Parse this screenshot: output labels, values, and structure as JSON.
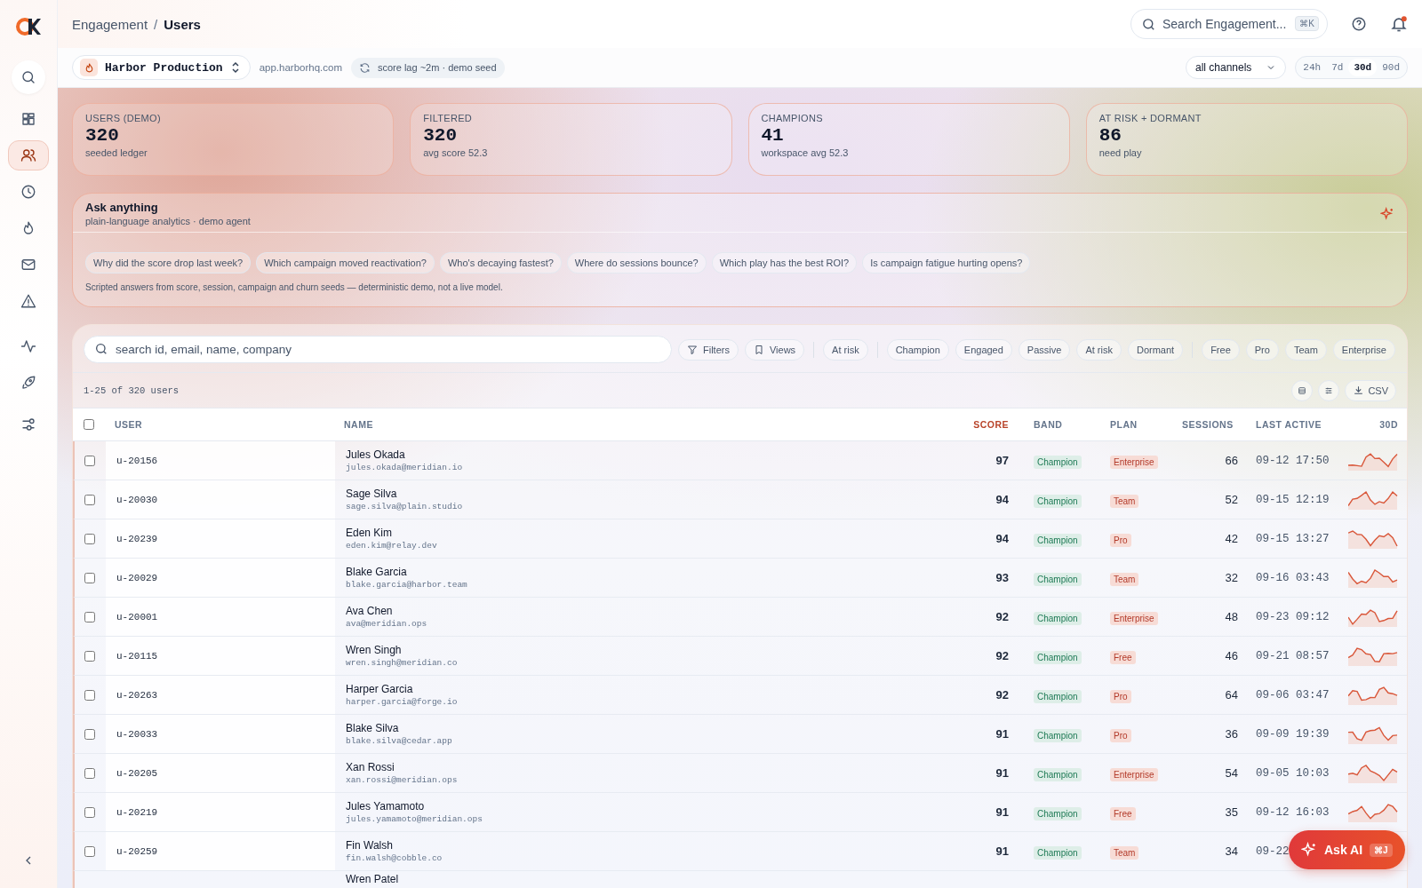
{
  "sidebar": {
    "items": [
      {
        "selected": false
      },
      {
        "selected": false
      },
      {
        "selected": true
      },
      {
        "selected": false
      },
      {
        "selected": false
      },
      {
        "selected": false
      },
      {
        "selected": false
      },
      {
        "selected": false
      },
      {
        "selected": false
      },
      {
        "selected": false
      }
    ]
  },
  "header": {
    "breadcrumb": [
      "Engagement",
      "Users"
    ],
    "separator": "/",
    "search": {
      "placeholder": "Search Engagement...",
      "shortcut": "⌘K"
    },
    "notifications": {
      "unread": true
    }
  },
  "subbar": {
    "workspace": "Harbor Production",
    "domain": "app.harborhq.com",
    "status": "score lag ~2m · demo seed",
    "channel": "all channels",
    "ranges": [
      {
        "label": "24h",
        "selected": false
      },
      {
        "label": "7d",
        "selected": false
      },
      {
        "label": "30d",
        "selected": true
      },
      {
        "label": "90d",
        "selected": false
      }
    ]
  },
  "stats": [
    {
      "label": "USERS (DEMO)",
      "value": "320",
      "note": "seeded ledger"
    },
    {
      "label": "FILTERED",
      "value": "320",
      "note": "avg score 52.3"
    },
    {
      "label": "CHAMPIONS",
      "value": "41",
      "note": "workspace avg 52.3"
    },
    {
      "label": "AT RISK + DORMANT",
      "value": "86",
      "note": "need play"
    }
  ],
  "ask": {
    "title": "Ask anything",
    "subtitle": "plain-language analytics · demo agent",
    "suggestions": [
      "Why did the score drop last week?",
      "Which campaign moved reactivation?",
      "Who's decaying fastest?",
      "Where do sessions bounce?",
      "Which play has the best ROI?",
      "Is campaign fatigue hurting opens?"
    ],
    "footnote": "Scripted answers from score, session, campaign and churn seeds — deterministic demo, not a live model."
  },
  "toolbar": {
    "search_placeholder": "search id, email, name, company",
    "buttons": [
      "Filters",
      "Views"
    ],
    "chip_groups": [
      [
        {
          "label": "At risk",
          "selected": false
        }
      ],
      [
        {
          "label": "Champion",
          "selected": false
        },
        {
          "label": "Engaged",
          "selected": false
        },
        {
          "label": "Passive",
          "selected": false
        },
        {
          "label": "At risk",
          "selected": false
        },
        {
          "label": "Dormant",
          "selected": false
        }
      ],
      [
        {
          "label": "Free",
          "selected": false
        },
        {
          "label": "Pro",
          "selected": false
        },
        {
          "label": "Team",
          "selected": false
        },
        {
          "label": "Enterprise",
          "selected": false
        }
      ]
    ]
  },
  "table": {
    "count": "1-25 of 320 users",
    "export": "CSV",
    "all_checked": false,
    "columns": [
      {
        "label": "USER",
        "sorted": false
      },
      {
        "label": "NAME",
        "sorted": false
      },
      {
        "label": "SCORE",
        "sorted": true
      },
      {
        "label": "BAND",
        "sorted": false
      },
      {
        "label": "PLAN",
        "sorted": false
      },
      {
        "label": "SESSIONS",
        "sorted": false
      },
      {
        "label": "LAST ACTIVE",
        "sorted": false
      },
      {
        "label": "30D",
        "sorted": false
      }
    ],
    "rows": [
      {
        "checked": false,
        "user": "u-20156",
        "name": "Jules Okada",
        "email": "jules.okada@meridian.io",
        "score": "97",
        "band": "Champion",
        "plan": "Enterprise",
        "sessions": "66",
        "last_active": "09-12 17:50"
      },
      {
        "checked": false,
        "user": "u-20030",
        "name": "Sage Silva",
        "email": "sage.silva@plain.studio",
        "score": "94",
        "band": "Champion",
        "plan": "Team",
        "sessions": "52",
        "last_active": "09-15 12:19"
      },
      {
        "checked": false,
        "user": "u-20239",
        "name": "Eden Kim",
        "email": "eden.kim@relay.dev",
        "score": "94",
        "band": "Champion",
        "plan": "Pro",
        "sessions": "42",
        "last_active": "09-15 13:27"
      },
      {
        "checked": false,
        "user": "u-20029",
        "name": "Blake Garcia",
        "email": "blake.garcia@harbor.team",
        "score": "93",
        "band": "Champion",
        "plan": "Team",
        "sessions": "32",
        "last_active": "09-16 03:43"
      },
      {
        "checked": false,
        "user": "u-20001",
        "name": "Ava Chen",
        "email": "ava@meridian.ops",
        "score": "92",
        "band": "Champion",
        "plan": "Enterprise",
        "sessions": "48",
        "last_active": "09-23 09:12"
      },
      {
        "checked": false,
        "user": "u-20115",
        "name": "Wren Singh",
        "email": "wren.singh@meridian.co",
        "score": "92",
        "band": "Champion",
        "plan": "Free",
        "sessions": "46",
        "last_active": "09-21 08:57"
      },
      {
        "checked": false,
        "user": "u-20263",
        "name": "Harper Garcia",
        "email": "harper.garcia@forge.io",
        "score": "92",
        "band": "Champion",
        "plan": "Pro",
        "sessions": "64",
        "last_active": "09-06 03:47"
      },
      {
        "checked": false,
        "user": "u-20033",
        "name": "Blake Silva",
        "email": "blake.silva@cedar.app",
        "score": "91",
        "band": "Champion",
        "plan": "Pro",
        "sessions": "36",
        "last_active": "09-09 19:39"
      },
      {
        "checked": false,
        "user": "u-20205",
        "name": "Xan Rossi",
        "email": "xan.rossi@meridian.ops",
        "score": "91",
        "band": "Champion",
        "plan": "Enterprise",
        "sessions": "54",
        "last_active": "09-05 10:03"
      },
      {
        "checked": false,
        "user": "u-20219",
        "name": "Jules Yamamoto",
        "email": "jules.yamamoto@meridian.ops",
        "score": "91",
        "band": "Champion",
        "plan": "Free",
        "sessions": "35",
        "last_active": "09-12 16:03"
      },
      {
        "checked": false,
        "user": "u-20259",
        "name": "Fin Walsh",
        "email": "fin.walsh@cobble.co",
        "score": "91",
        "band": "Champion",
        "plan": "Team",
        "sessions": "34",
        "last_active": "09-22",
        "trend_covered": true
      }
    ],
    "partial_row": {
      "name": "Wren Patel"
    }
  },
  "ask_ai": {
    "label": "Ask AI",
    "shortcut": "⌘J"
  }
}
